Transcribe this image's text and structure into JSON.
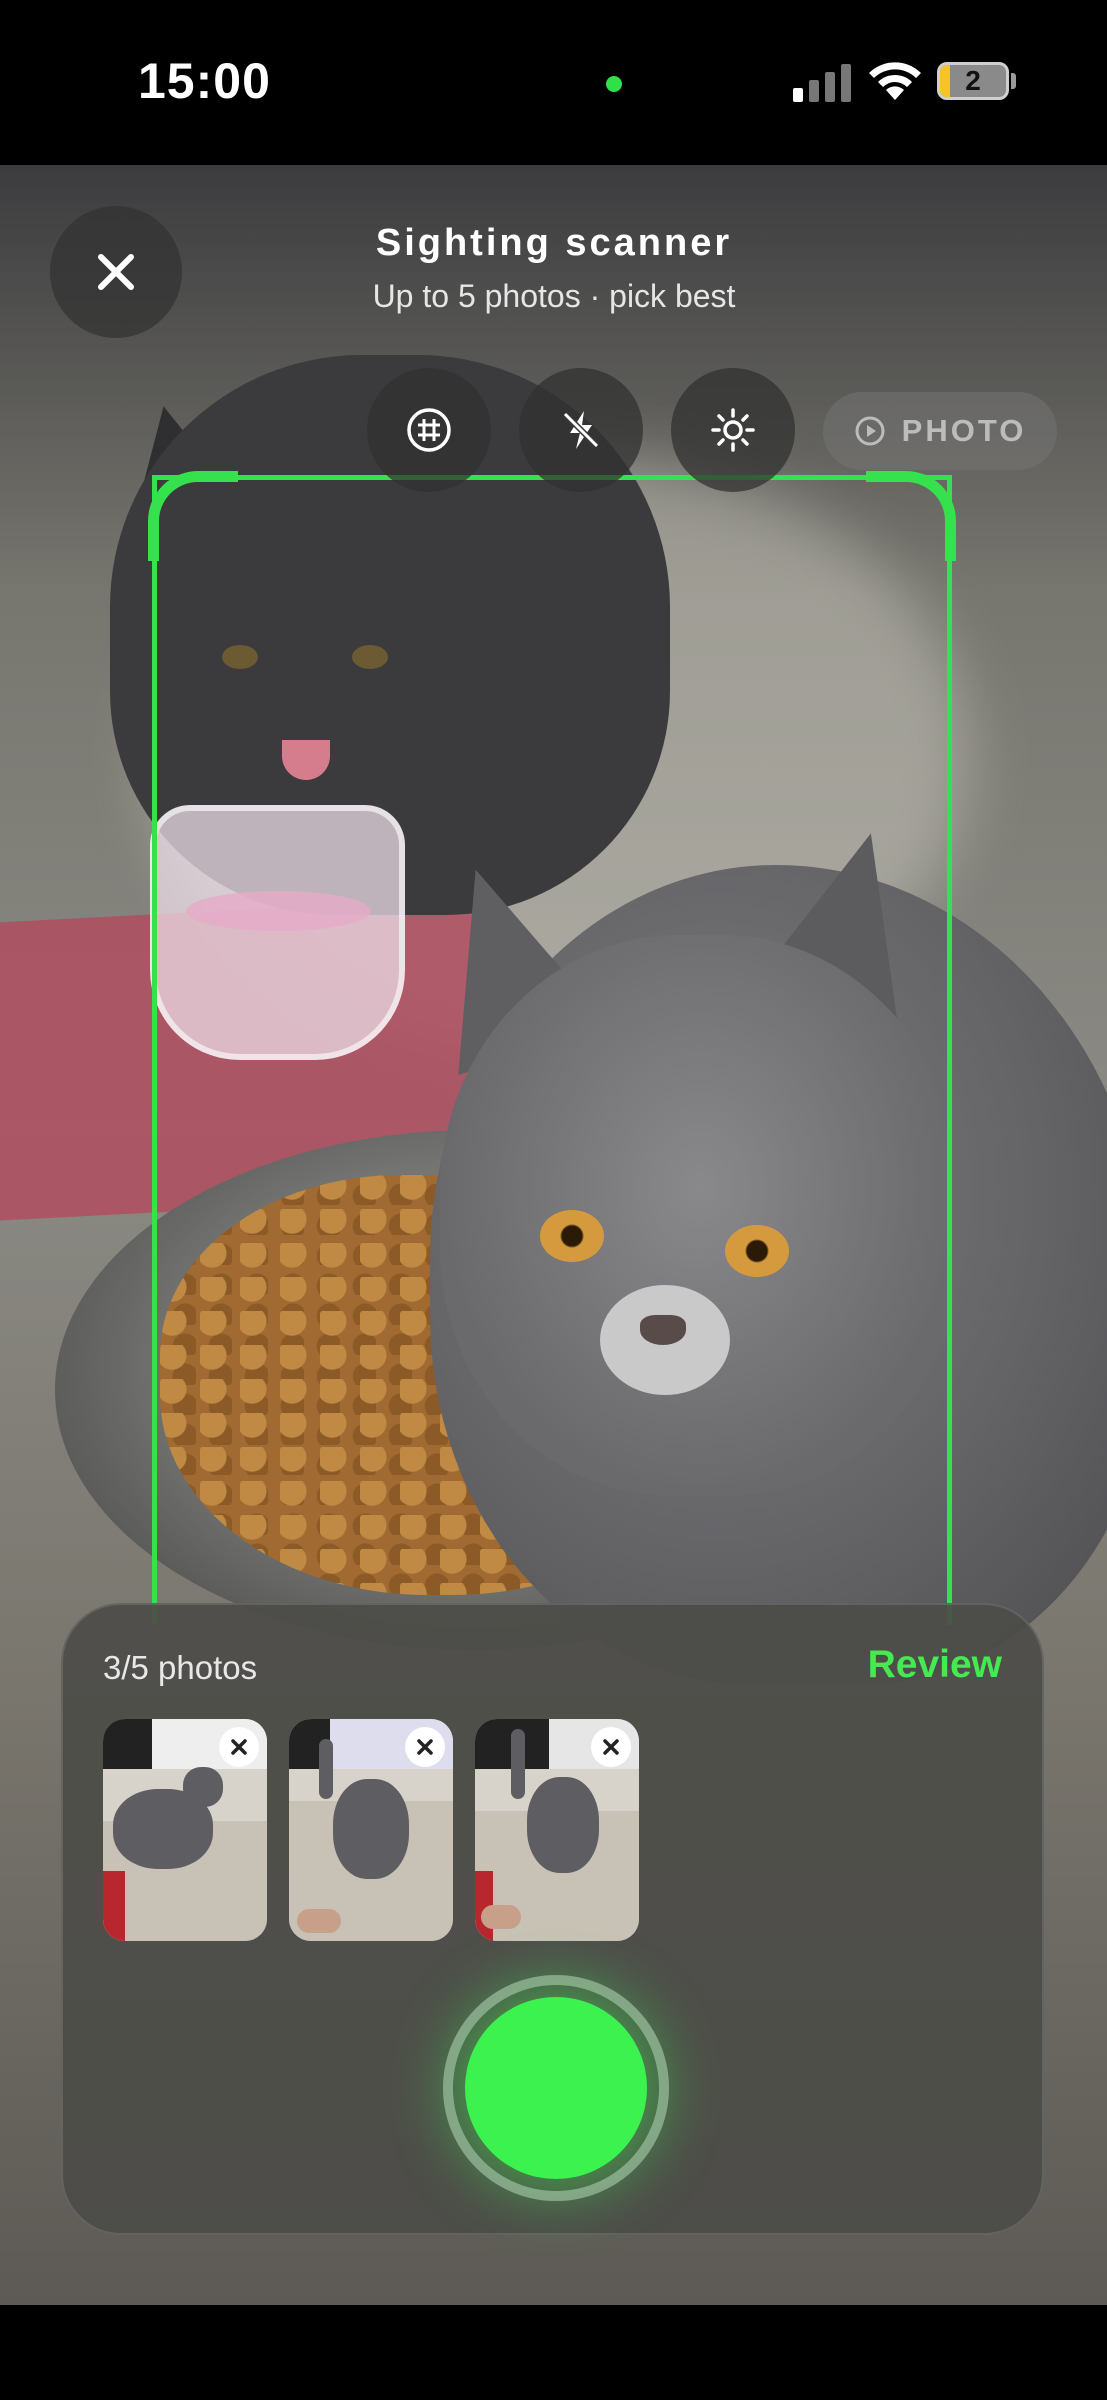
{
  "status_bar": {
    "time": "15:00",
    "battery_level": "2",
    "icons": [
      "privacy-dot-icon",
      "cellular-signal-icon",
      "wifi-icon",
      "battery-icon"
    ]
  },
  "header": {
    "title": "Sighting scanner",
    "subtitle": "Up to 5 photos · pick best",
    "close_icon": "close-icon"
  },
  "toolbar": {
    "tools": [
      {
        "name": "grid-toggle",
        "icon": "grid-icon"
      },
      {
        "name": "flash-toggle",
        "icon": "flash-off-icon"
      },
      {
        "name": "exposure-toggle",
        "icon": "brightness-icon"
      }
    ],
    "mode_label": "PHOTO",
    "mode_icon": "photo-mode-icon"
  },
  "capture_panel": {
    "count_label": "3/5 photos",
    "review_label": "Review",
    "thumbnails": [
      {
        "name": "cat-photo-1",
        "remove_icon": "remove-icon"
      },
      {
        "name": "cat-photo-2",
        "remove_icon": "remove-icon"
      },
      {
        "name": "cat-photo-3",
        "remove_icon": "remove-icon"
      }
    ],
    "shutter_icon": "shutter-icon"
  },
  "colors": {
    "accent": "#35e24e",
    "shutter": "#3bf24f",
    "review_text": "#44ea4f",
    "panel": "#4c4c48"
  }
}
